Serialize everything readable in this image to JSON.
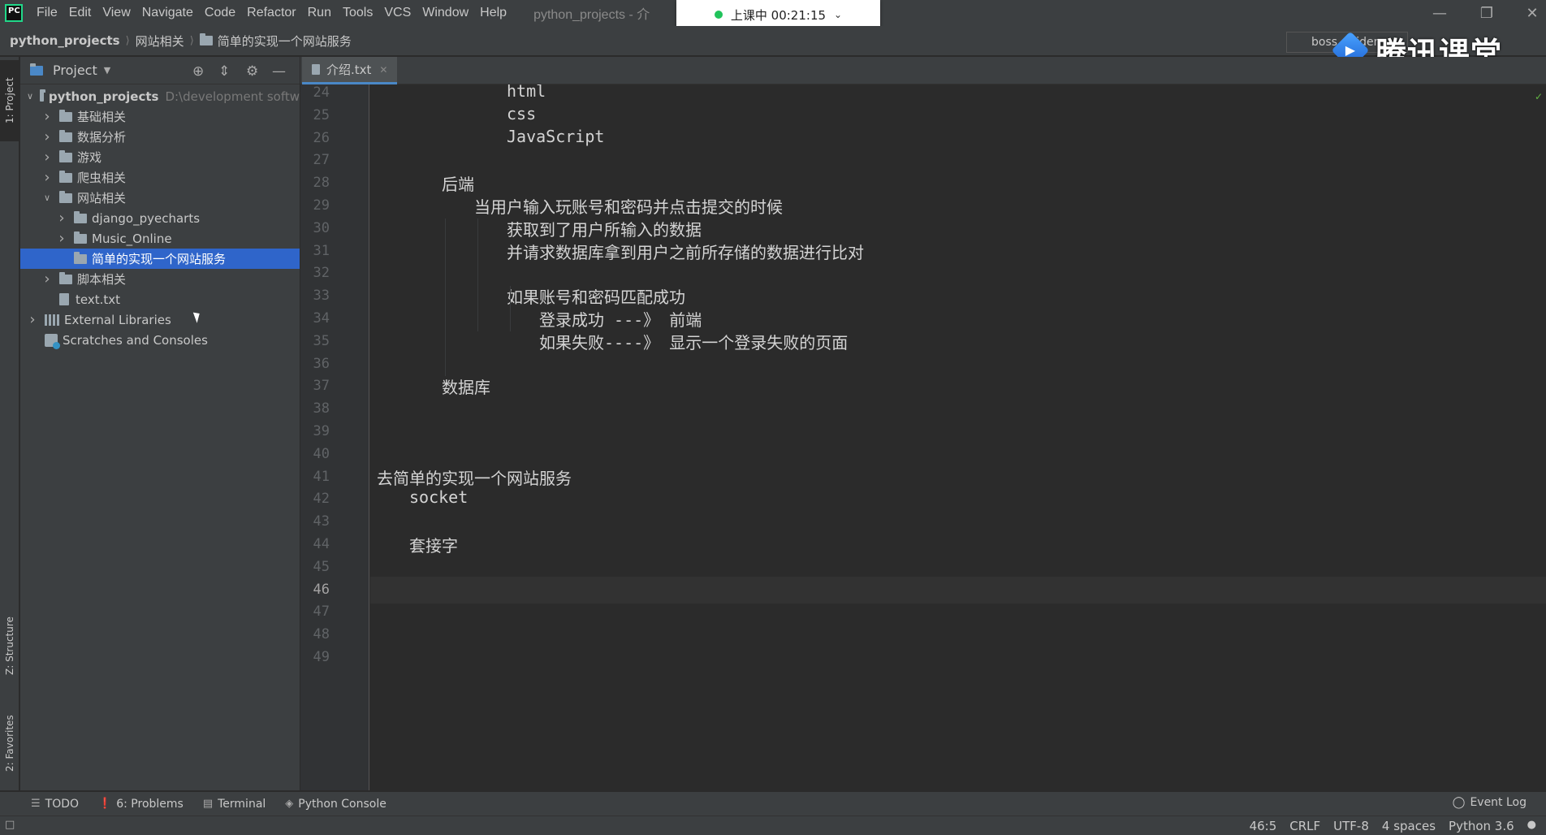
{
  "menubar": {
    "logo": "PC",
    "items": [
      "File",
      "Edit",
      "View",
      "Navigate",
      "Code",
      "Refactor",
      "Run",
      "Tools",
      "VCS",
      "Window",
      "Help"
    ],
    "window_title": "python_projects - 介"
  },
  "overlay": {
    "class_timer": "上课中 00:21:15",
    "brand": "腾讯课堂"
  },
  "breadcrumb": [
    "python_projects",
    "网站相关",
    "简单的实现一个网站服务"
  ],
  "run_config": "boss_spider",
  "left_strip": {
    "project_tab": "1: Project",
    "structure_tab": "Z: Structure",
    "favorites_tab": "2: Favorites"
  },
  "project_panel": {
    "title": "Project",
    "tree": [
      {
        "label": "python_projects",
        "sub": "D:\\development softw",
        "level": 0,
        "expanded": true,
        "type": "root"
      },
      {
        "label": "基础相关",
        "level": 1,
        "expanded": false,
        "type": "folder"
      },
      {
        "label": "数据分析",
        "level": 1,
        "expanded": false,
        "type": "folder"
      },
      {
        "label": "游戏",
        "level": 1,
        "expanded": false,
        "type": "folder"
      },
      {
        "label": "爬虫相关",
        "level": 1,
        "expanded": false,
        "type": "folder"
      },
      {
        "label": "网站相关",
        "level": 1,
        "expanded": true,
        "type": "folder"
      },
      {
        "label": "django_pyecharts",
        "level": 2,
        "expanded": false,
        "type": "folder"
      },
      {
        "label": "Music_Online",
        "level": 2,
        "expanded": false,
        "type": "folder"
      },
      {
        "label": "简单的实现一个网站服务",
        "level": 2,
        "selected": true,
        "type": "folder-leaf"
      },
      {
        "label": "脚本相关",
        "level": 1,
        "expanded": false,
        "type": "folder"
      },
      {
        "label": "text.txt",
        "level": 1,
        "type": "file"
      },
      {
        "label": "External Libraries",
        "level": 0,
        "expanded": false,
        "type": "library"
      },
      {
        "label": "Scratches and Consoles",
        "level": 0,
        "type": "scratch"
      }
    ]
  },
  "editor": {
    "tab_label": "介绍.txt",
    "current_line": 46,
    "lines": [
      {
        "n": 24,
        "indent": 4,
        "text": "html"
      },
      {
        "n": 25,
        "indent": 4,
        "text": "css"
      },
      {
        "n": 26,
        "indent": 4,
        "text": "JavaScript"
      },
      {
        "n": 27,
        "indent": 0,
        "text": ""
      },
      {
        "n": 28,
        "indent": 2,
        "text": "后端"
      },
      {
        "n": 29,
        "indent": 3,
        "text": "当用户输入玩账号和密码并点击提交的时候"
      },
      {
        "n": 30,
        "indent": 4,
        "text": "获取到了用户所输入的数据"
      },
      {
        "n": 31,
        "indent": 4,
        "text": "并请求数据库拿到用户之前所存储的数据进行比对"
      },
      {
        "n": 32,
        "indent": 0,
        "text": ""
      },
      {
        "n": 33,
        "indent": 4,
        "text": "如果账号和密码匹配成功"
      },
      {
        "n": 34,
        "indent": 5,
        "text": "登录成功 ---》 前端"
      },
      {
        "n": 35,
        "indent": 5,
        "text": "如果失败----》 显示一个登录失败的页面"
      },
      {
        "n": 36,
        "indent": 0,
        "text": ""
      },
      {
        "n": 37,
        "indent": 2,
        "text": "数据库"
      },
      {
        "n": 38,
        "indent": 0,
        "text": ""
      },
      {
        "n": 39,
        "indent": 0,
        "text": ""
      },
      {
        "n": 40,
        "indent": 0,
        "text": ""
      },
      {
        "n": 41,
        "indent": 0,
        "text": "去简单的实现一个网站服务"
      },
      {
        "n": 42,
        "indent": 1,
        "text": "socket"
      },
      {
        "n": 43,
        "indent": 0,
        "text": ""
      },
      {
        "n": 44,
        "indent": 1,
        "text": "套接字"
      },
      {
        "n": 45,
        "indent": 0,
        "text": ""
      },
      {
        "n": 46,
        "indent": 0,
        "text": ""
      },
      {
        "n": 47,
        "indent": 0,
        "text": ""
      },
      {
        "n": 48,
        "indent": 0,
        "text": ""
      },
      {
        "n": 49,
        "indent": 0,
        "text": ""
      }
    ]
  },
  "toolwindows": {
    "todo": "TODO",
    "problems": "6: Problems",
    "terminal": "Terminal",
    "python_console": "Python Console",
    "event_log": "Event Log"
  },
  "status": {
    "position": "46:5",
    "line_sep": "CRLF",
    "encoding": "UTF-8",
    "indent": "4 spaces",
    "interpreter": "Python 3.6"
  }
}
